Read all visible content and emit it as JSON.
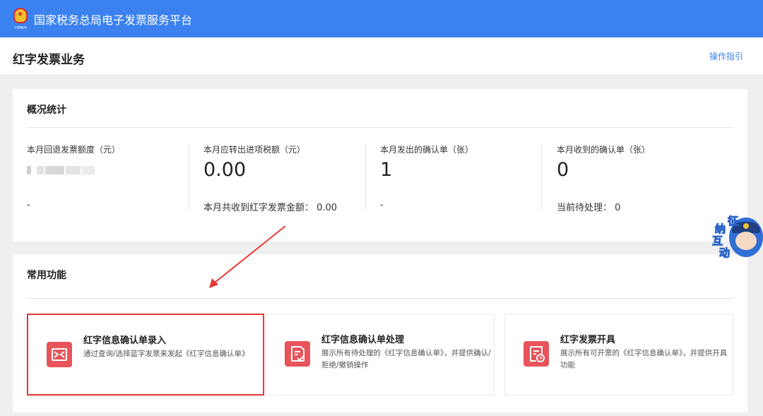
{
  "platform": {
    "title": "国家税务总局电子发票服务平台",
    "emblem_caption": "中国税务"
  },
  "header": {
    "page_title": "红字发票业务",
    "guide_link": "操作指引"
  },
  "overview": {
    "title": "概况统计",
    "stats": [
      {
        "label": "本月回退发票额度（元）",
        "value": "",
        "value_redacted": true,
        "foot": "-"
      },
      {
        "label": "本月应转出进项税额（元）",
        "value": "0.00",
        "foot": "本月共收到红字发票金额：  0.00"
      },
      {
        "label": "本月发出的确认单（张）",
        "value": "1",
        "foot": "-"
      },
      {
        "label": "本月收到的确认单（张）",
        "value": "0",
        "foot": "当前待处理：  0"
      }
    ]
  },
  "functions": {
    "title": "常用功能",
    "items": [
      {
        "title": "红字信息确认单录入",
        "desc": "通过查询/选择蓝字发票来发起《红字信息确认单》",
        "icon": "swap-arrows-icon",
        "selected": true
      },
      {
        "title": "红字信息确认单处理",
        "desc": "展示所有待处理的《红字信息确认单》，并提供确认/拒绝/撤销操作",
        "icon": "document-check-icon"
      },
      {
        "title": "红字发票开具",
        "desc": "展示所有可开票的《红字信息确认单》，并提供开具功能",
        "icon": "invoice-clock-icon"
      }
    ]
  },
  "mascot": {
    "chars": [
      "征",
      "纳",
      "互",
      "动"
    ]
  },
  "colors": {
    "brand_blue": "#3b82f0",
    "highlight_red": "#e53935",
    "icon_red": "#e8545a"
  }
}
